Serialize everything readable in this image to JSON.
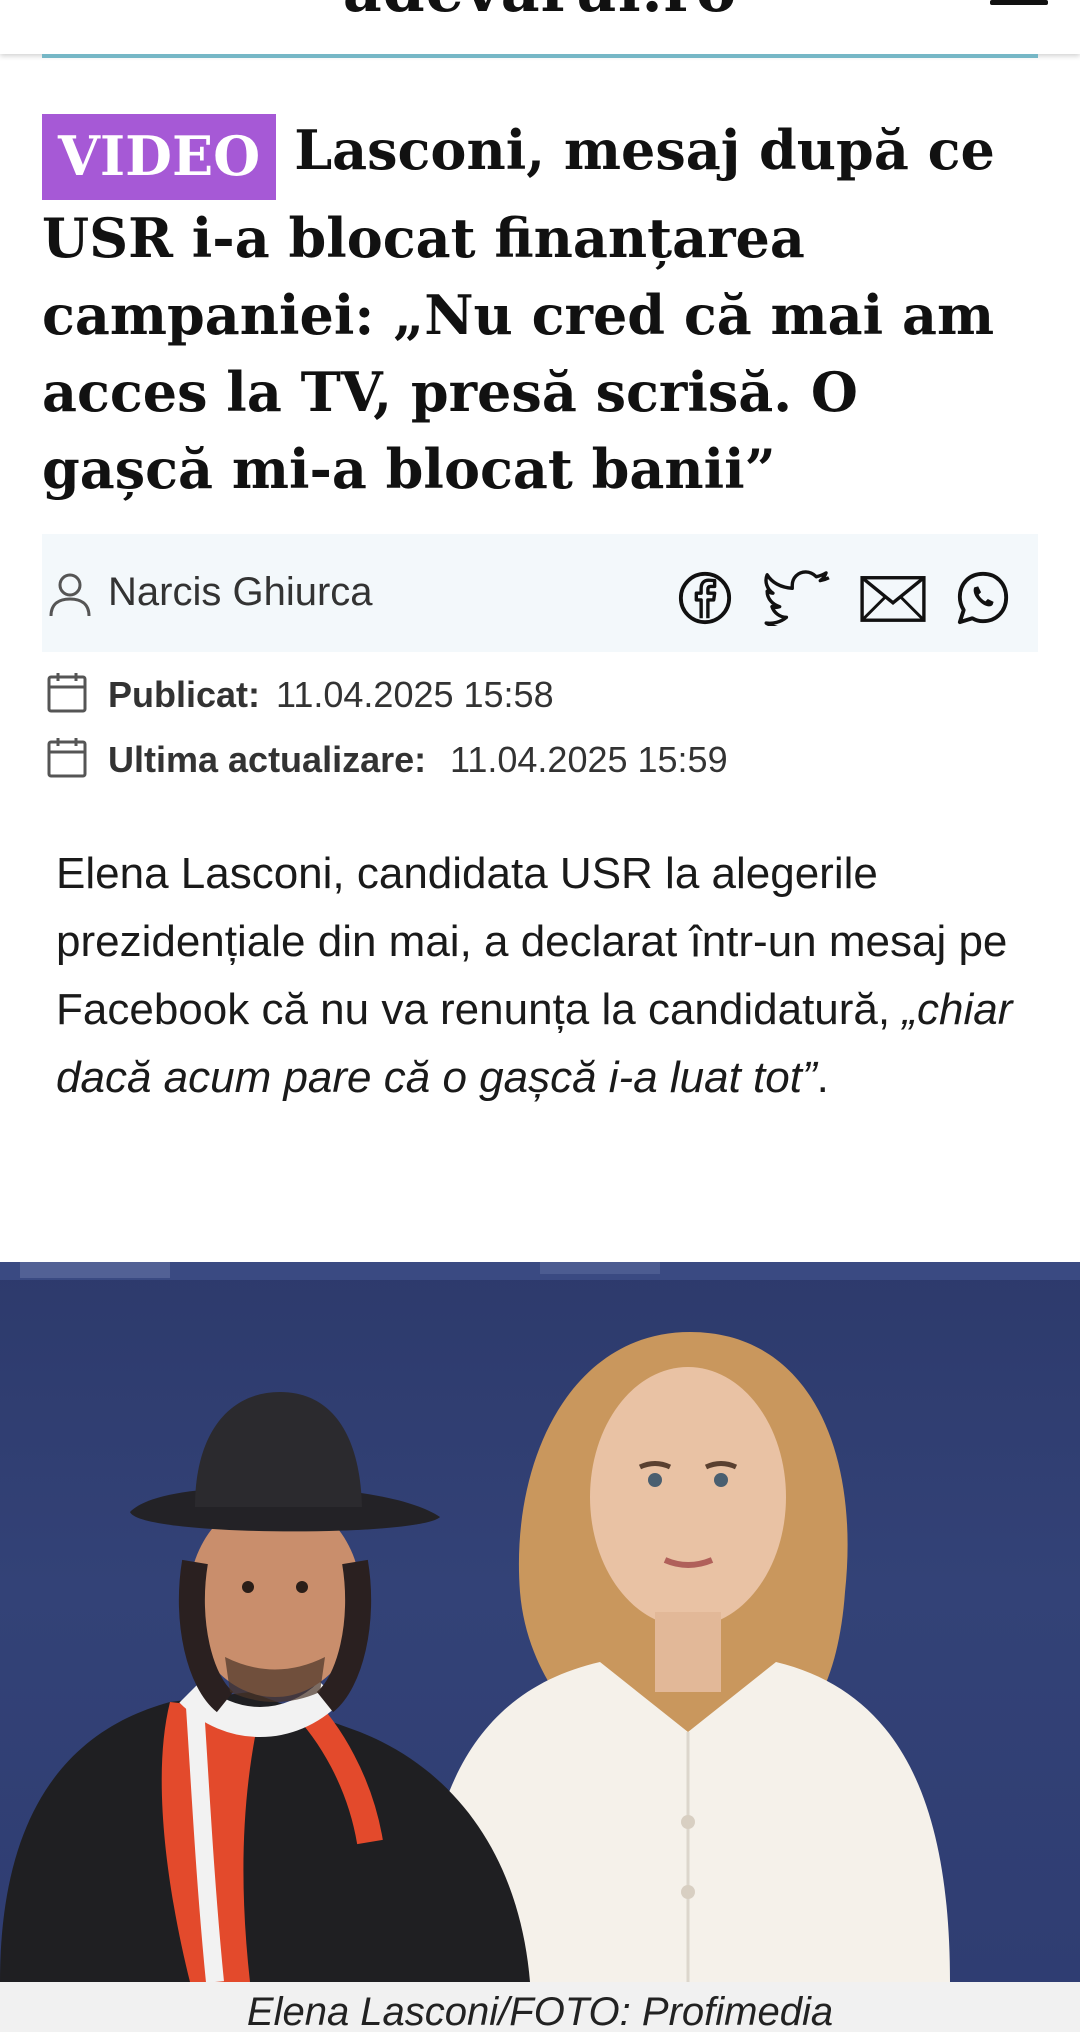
{
  "site": {
    "logo": "adevarul.ro"
  },
  "article": {
    "badge": "VIDEO",
    "headline": "Lasconi, mesaj după ce USR i-a blocat finanțarea campaniei: „Nu cred că mai am acces la TV, presă scrisă. O gașcă mi-a blocat banii”",
    "author": "Narcis Ghiurca",
    "published_label": "Publicat:",
    "published_value": "11.04.2025 15:58",
    "updated_label": "Ultima actualizare:",
    "updated_value": "11.04.2025 15:59",
    "lead_plain": "Elena Lasconi, candidata USR la alegerile prezidențiale din mai, a declarat într-un mesaj pe Facebook că nu va renunța la candidatură, ",
    "lead_quote": "„chiar dacă acum pare că o gașcă i-a luat tot”",
    "lead_end": ".",
    "photo_caption": "Elena Lasconi/FOTO: Profimedia"
  },
  "share": {
    "icons": [
      "facebook-icon",
      "twitter-icon",
      "email-icon",
      "whatsapp-icon"
    ]
  },
  "colors": {
    "badge": "#a659d6",
    "accent_line": "#76b7c6",
    "author_bar": "#f3f8fb"
  }
}
